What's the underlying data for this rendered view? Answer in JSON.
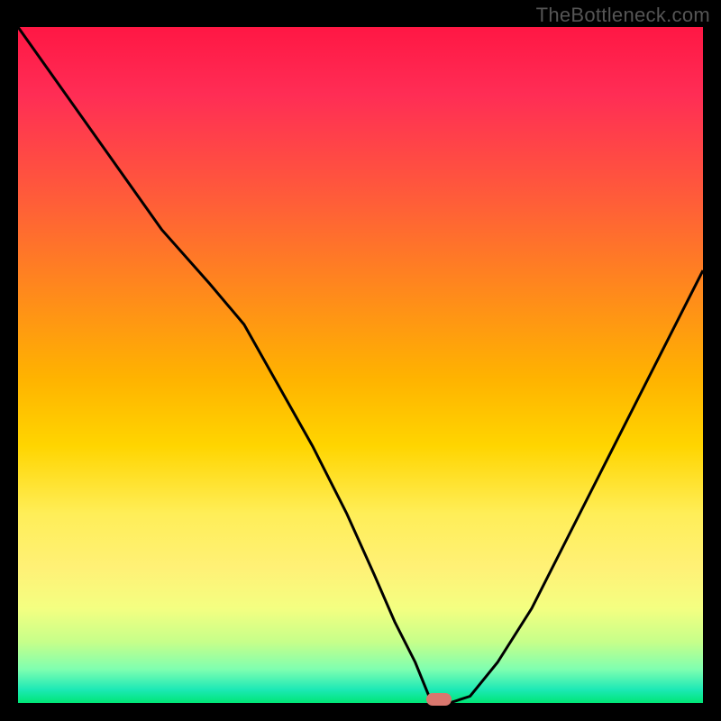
{
  "watermark": "TheBottleneck.com",
  "chart_data": {
    "type": "line",
    "title": "",
    "xlabel": "",
    "ylabel": "",
    "x_range": [
      0,
      100
    ],
    "y_range": [
      0,
      100
    ],
    "series": [
      {
        "name": "bottleneck-curve",
        "x": [
          0,
          7,
          14,
          21,
          28,
          33,
          38,
          43,
          48,
          52,
          55,
          58,
          60,
          63,
          66,
          70,
          75,
          80,
          85,
          90,
          95,
          100
        ],
        "y": [
          100,
          90,
          80,
          70,
          62,
          56,
          47,
          38,
          28,
          19,
          12,
          6,
          1,
          0,
          1,
          6,
          14,
          24,
          34,
          44,
          54,
          64
        ]
      }
    ],
    "optimum": {
      "x": 61.5,
      "y": 0
    },
    "gradient_meaning": "red=high bottleneck, green=balanced",
    "colors": {
      "top": "#ff1744",
      "mid": "#ffd500",
      "bottom": "#00e676",
      "curve": "#000000",
      "marker": "#d9776e",
      "watermark": "#555555"
    }
  }
}
